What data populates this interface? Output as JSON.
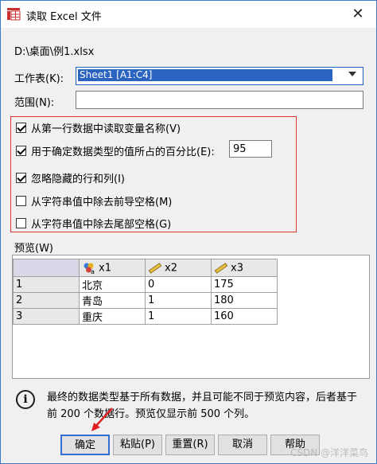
{
  "window": {
    "title": "读取 Excel 文件",
    "close_glyph": "✕"
  },
  "file_path": "D:\\桌面\\例1.xlsx",
  "worksheet": {
    "label": "工作表(K):",
    "value": "Sheet1 [A1:C4]"
  },
  "range": {
    "label": "范围(N):",
    "value": ""
  },
  "options": [
    {
      "label": "从第一行数据中读取变量名称(V)",
      "checked": true
    },
    {
      "label": "用于确定数据类型的值所占的百分比(E):",
      "checked": true
    },
    {
      "label": "忽略隐藏的行和列(I)",
      "checked": true
    },
    {
      "label": "从字符串值中除去前导空格(M)",
      "checked": false
    },
    {
      "label": "从字符串值中除去尾部空格(G)",
      "checked": false
    }
  ],
  "percent_value": "95",
  "preview": {
    "label": "预览(W)",
    "columns": [
      {
        "name": "x1",
        "icon": "nominal-string-icon"
      },
      {
        "name": "x2",
        "icon": "scale-ruler-icon"
      },
      {
        "name": "x3",
        "icon": "scale-ruler-icon"
      }
    ],
    "rows": [
      {
        "num": "1",
        "cells": [
          "北京",
          "0",
          "175"
        ]
      },
      {
        "num": "2",
        "cells": [
          "青岛",
          "1",
          "180"
        ]
      },
      {
        "num": "3",
        "cells": [
          "重庆",
          "1",
          "160"
        ]
      }
    ]
  },
  "info": {
    "icon": "info-icon",
    "glyph": "i",
    "text": "最终的数据类型基于所有数据，并且可能不同于预览内容，后者基于前 200 个数据行。预览仅显示前 500 个列。"
  },
  "buttons": {
    "ok": "确定",
    "paste": "粘贴(P)",
    "reset": "重置(R)",
    "cancel": "取消",
    "help": "帮助"
  },
  "watermark": "CSDN @洋洋菜鸟",
  "colors": {
    "accent": "#2f6fd0",
    "highlight_border": "#e03030",
    "annotation_arrow": "#e02020"
  }
}
